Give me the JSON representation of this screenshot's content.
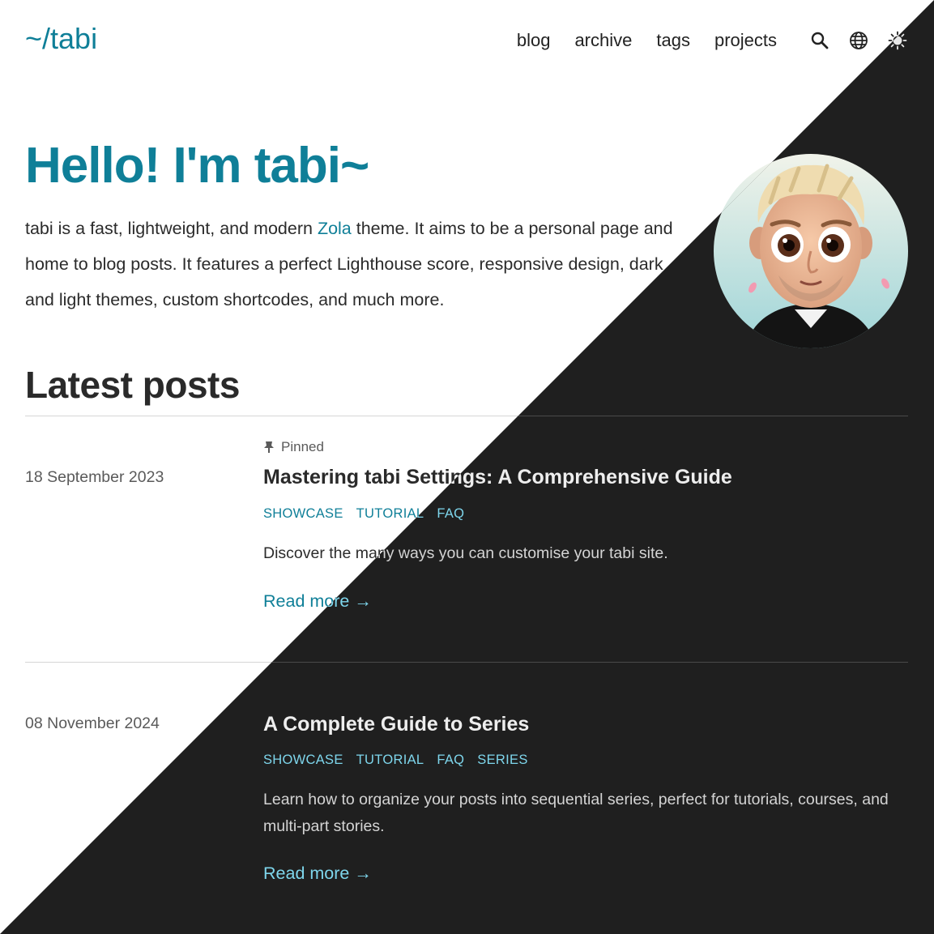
{
  "site": {
    "logo": "~/tabi",
    "nav": [
      {
        "label": "blog"
      },
      {
        "label": "archive"
      },
      {
        "label": "tags"
      },
      {
        "label": "projects"
      }
    ],
    "icons": [
      "search-icon",
      "language-globe-icon",
      "theme-toggle-sun-icon"
    ]
  },
  "hero": {
    "title": "Hello! I'm tabi~",
    "text_before": "tabi is a fast, lightweight, and modern ",
    "link": "Zola",
    "text_after": " theme. It aims to be a personal page and home to blog posts. It features a perfect Lighthouse score, responsive design, dark and light themes, custom shortcodes, and much more."
  },
  "section": {
    "title": "Latest posts"
  },
  "posts": [
    {
      "pinned_label": "Pinned",
      "date": "18 September 2023",
      "title": "Mastering tabi Settings: A Comprehensive Guide",
      "tags": [
        "SHOWCASE",
        "TUTORIAL",
        "FAQ"
      ],
      "summary": "Discover the many ways you can customise your tabi site.",
      "read_more": "Read more →"
    },
    {
      "date": "08 November 2024",
      "title": "A Complete Guide to Series",
      "tags": [
        "SHOWCASE",
        "TUTORIAL",
        "FAQ",
        "SERIES"
      ],
      "summary": "Learn how to organize your posts into sequential series, perfect for tutorials, courses, and multi-part stories.",
      "read_more": "Read more →"
    }
  ],
  "colors": {
    "accent_light": "#0f7f98",
    "accent_dark": "#7ed6ec",
    "background_light": "#ffffff",
    "background_dark": "#1f1f1f"
  }
}
